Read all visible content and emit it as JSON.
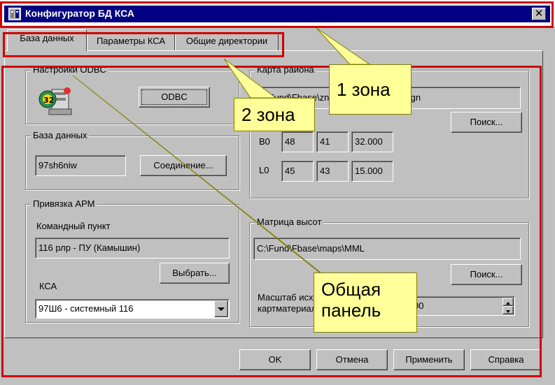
{
  "window": {
    "title": "Конфигуратор БД КСА",
    "close_glyph": "✕"
  },
  "tabs": [
    {
      "label": "База данных",
      "active": true
    },
    {
      "label": "Параметры КСА",
      "active": false
    },
    {
      "label": "Общие директории",
      "active": false
    }
  ],
  "odbc": {
    "group_label": "Настройки ODBC",
    "button_label": "ODBC",
    "icon": "odbc-config-icon"
  },
  "database": {
    "group_label": "База данных",
    "value": "97sh6niw",
    "connect_button": "Соединение..."
  },
  "arm": {
    "group_label": "Привязка АРМ",
    "command_post_label": "Командный пункт",
    "command_post_value": "116 рлр - ПУ (Камышин)",
    "select_button": "Выбрать...",
    "ksa_label": "КСА",
    "ksa_value": "97Ш6 - системный 116"
  },
  "region_map": {
    "group_label": "Карта района",
    "path": "C:\\Fund\\Fbase\\znamensk\\znamensk.rgn",
    "search_button": "Поиск...",
    "b0_label": "B0",
    "b0": [
      "48",
      "41",
      "32.000"
    ],
    "l0_label": "L0",
    "l0": [
      "45",
      "43",
      "15.000"
    ]
  },
  "height_matrix": {
    "group_label": "Матрица высот",
    "path": "C:\\Fund\\Fbase\\maps\\MML",
    "search_button": "Поиск...",
    "scale_label_line1": "Масштаб исходного",
    "scale_label_line2": "картматериала",
    "scale_value": "00"
  },
  "footer": {
    "ok": "OK",
    "cancel": "Отмена",
    "apply": "Применить",
    "help": "Справка"
  },
  "annotations": {
    "zone1": "1 зона",
    "zone2": "2 зона",
    "panel_line1": "Общая",
    "panel_line2": "панель",
    "accent_color": "#d00000",
    "callout_color": "#ffff99"
  }
}
